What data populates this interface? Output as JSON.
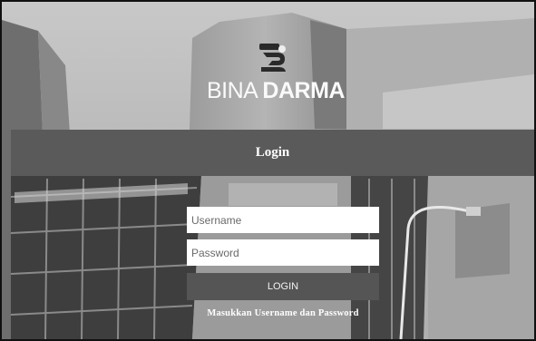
{
  "brand": {
    "name_light": "BINA ",
    "name_bold": "DARMA",
    "logo_icon": "bina-darma-logo-mark"
  },
  "login_header": {
    "title": "Login"
  },
  "form": {
    "username": {
      "placeholder": "Username",
      "value": ""
    },
    "password": {
      "placeholder": "Password",
      "value": ""
    },
    "submit_label": "LOGIN",
    "hint": "Masukkan Username dan Password"
  },
  "colors": {
    "header_bar": "#5a5a5a",
    "button": "#555555",
    "field_bg": "#ffffff",
    "text_light": "#ffffff"
  }
}
